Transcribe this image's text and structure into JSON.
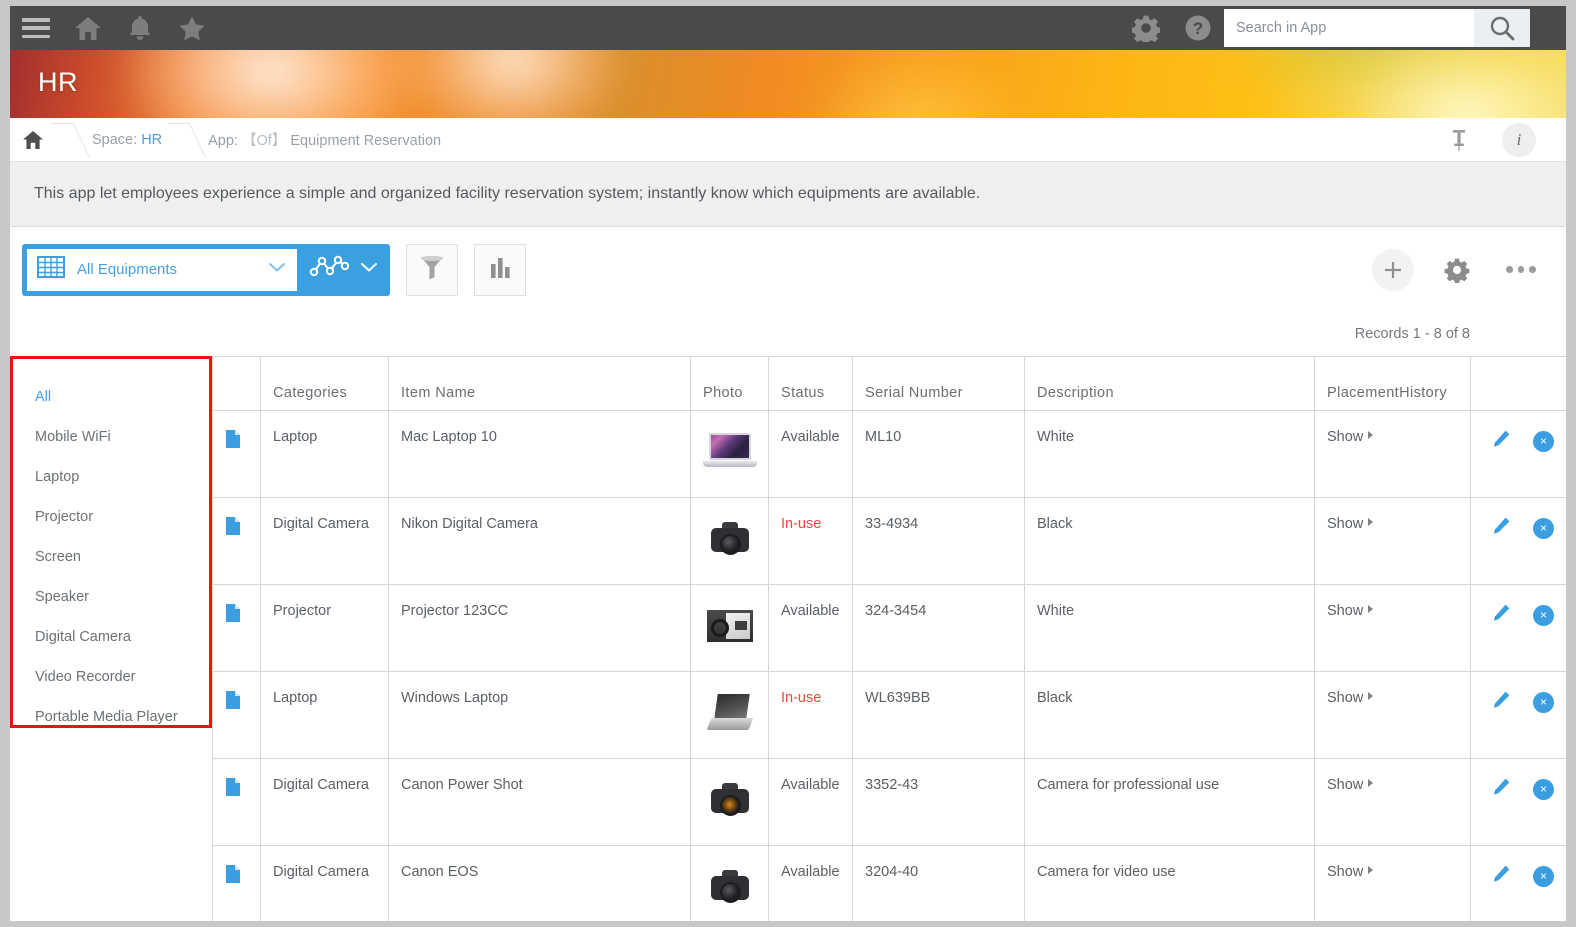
{
  "topbar": {
    "icons": [
      {
        "name": "hamburger-menu-icon",
        "label": "Menu"
      },
      {
        "name": "home-icon",
        "label": "Home"
      },
      {
        "name": "bell-icon",
        "label": "Notifications"
      },
      {
        "name": "star-icon",
        "label": "Favorites"
      }
    ],
    "gear_label": "Settings",
    "help_label": "Help",
    "search_placeholder": "Search in App",
    "search_value": "",
    "search_button_label": "Search"
  },
  "banner": {
    "title": "HR"
  },
  "breadcrumb": {
    "home_label": "Home",
    "space_prefix": "Space:",
    "space_name": "HR",
    "app_prefix": "App:",
    "app_bracket": "【Of】",
    "app_name": "Equipment Reservation",
    "pin_label": "Pin",
    "info_label": "i"
  },
  "description": {
    "text": "This app let employees experience a simple and organized facility reservation system; instantly know which equipments are available."
  },
  "toolbar": {
    "view_label": "All Equipments",
    "view_icon": "table-view-icon",
    "chart_icon": "line-chart-icon",
    "filter_label": "Filter",
    "graph_label": "Chart",
    "add_label": "Add record",
    "settings_label": "App settings",
    "more_label": "More options"
  },
  "records": {
    "text": "Records 1 - 8 of 8"
  },
  "sidebar": {
    "items": [
      {
        "label": "All",
        "active": true
      },
      {
        "label": "Mobile WiFi",
        "active": false
      },
      {
        "label": "Laptop",
        "active": false
      },
      {
        "label": "Projector",
        "active": false
      },
      {
        "label": "Screen",
        "active": false
      },
      {
        "label": "Speaker",
        "active": false
      },
      {
        "label": "Digital Camera",
        "active": false
      },
      {
        "label": "Video Recorder",
        "active": false
      },
      {
        "label": "Portable Media Player",
        "active": false
      }
    ]
  },
  "table": {
    "columns": [
      {
        "key": "flag",
        "label": ""
      },
      {
        "key": "categories",
        "label": "Categories"
      },
      {
        "key": "item_name",
        "label": "Item Name"
      },
      {
        "key": "photo",
        "label": "Photo"
      },
      {
        "key": "status",
        "label": "Status"
      },
      {
        "key": "serial",
        "label": "Serial Number"
      },
      {
        "key": "description",
        "label": "Description"
      },
      {
        "key": "history",
        "label": "PlacementHistory"
      },
      {
        "key": "actions",
        "label": ""
      }
    ],
    "show_label": "Show",
    "edit_label": "Edit",
    "delete_label": "×",
    "rows": [
      {
        "categories": "Laptop",
        "item_name": "Mac Laptop 10",
        "photo": "macbook-thumbnail",
        "status": "Available",
        "status_state": "available",
        "serial": "ML10",
        "description": "White",
        "history": "Show"
      },
      {
        "categories": "Digital Camera",
        "item_name": "Nikon Digital Camera",
        "photo": "dslr-camera-thumbnail",
        "status": "In-use",
        "status_state": "in-use",
        "serial": "33-4934",
        "description": "Black",
        "history": "Show"
      },
      {
        "categories": "Projector",
        "item_name": "Projector 123CC",
        "photo": "projector-thumbnail",
        "status": "Available",
        "status_state": "available",
        "serial": "324-3454",
        "description": "White",
        "history": "Show"
      },
      {
        "categories": "Laptop",
        "item_name": "Windows Laptop",
        "photo": "windows-laptop-thumbnail",
        "status": "In-use",
        "status_state": "in-use",
        "serial": "WL639BB",
        "description": "Black",
        "history": "Show"
      },
      {
        "categories": "Digital Camera",
        "item_name": "Canon Power Shot",
        "photo": "bridge-camera-thumbnail",
        "status": "Available",
        "status_state": "available",
        "serial": "3352-43",
        "description": "Camera for professional use",
        "history": "Show"
      },
      {
        "categories": "Digital Camera",
        "item_name": "Canon EOS",
        "photo": "dslr-camera-thumbnail",
        "status": "Available",
        "status_state": "available",
        "serial": "3204-40",
        "description": "Camera for video use",
        "history": "Show"
      }
    ]
  },
  "colors": {
    "accent_blue": "#3aa0e0",
    "link_blue": "#4a9fe0",
    "status_inuse_red": "#f1453d",
    "highlight_red": "#f10f0f",
    "topbar_dark": "#4a4a4a"
  }
}
